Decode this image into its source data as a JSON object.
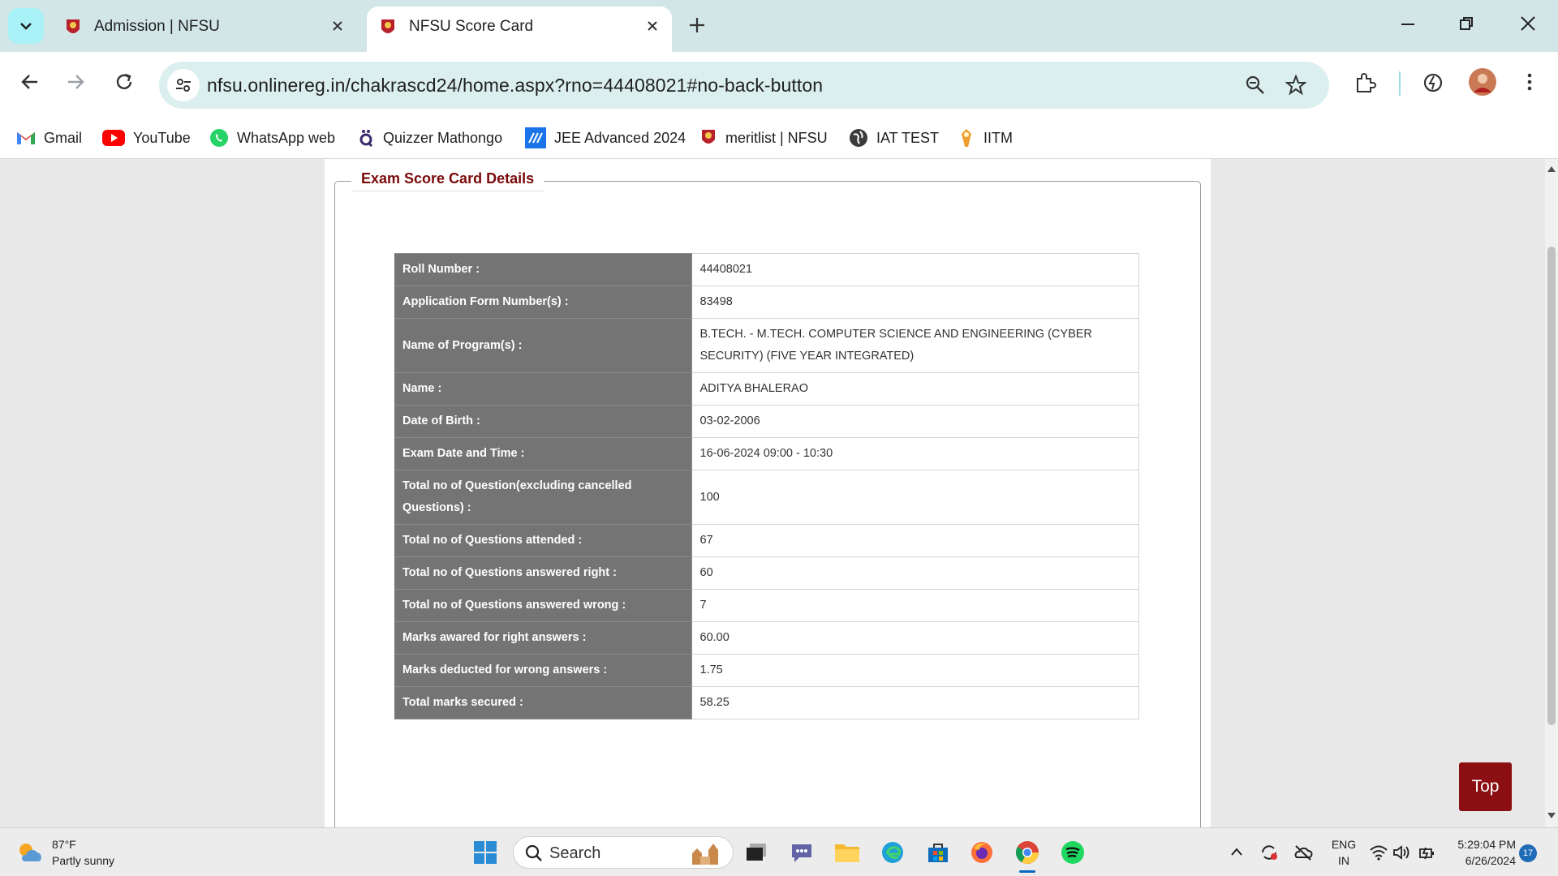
{
  "browser": {
    "tabs": [
      {
        "title": "Admission | NFSU",
        "active": false
      },
      {
        "title": "NFSU Score Card",
        "active": true
      }
    ],
    "url": "nfsu.onlinereg.in/chakrascd24/home.aspx?rno=44408021#no-back-button",
    "bookmarks": [
      {
        "label": "Gmail",
        "icon": "gmail-icon"
      },
      {
        "label": "YouTube",
        "icon": "youtube-icon"
      },
      {
        "label": "WhatsApp web",
        "icon": "whatsapp-icon"
      },
      {
        "label": "Quizzer Mathongo",
        "icon": "quizzer-icon"
      },
      {
        "label": "JEE Advanced 2024",
        "icon": "jee-icon"
      },
      {
        "label": "meritlist | NFSU",
        "icon": "nfsu-icon"
      },
      {
        "label": "IAT TEST",
        "icon": "globe-icon"
      },
      {
        "label": "IITM",
        "icon": "iitm-icon"
      }
    ]
  },
  "page": {
    "legend": "Exam Score Card Details",
    "rows": [
      {
        "label": "Roll Number :",
        "value": "44408021"
      },
      {
        "label": "Application Form Number(s) :",
        "value": "83498"
      },
      {
        "label": "Name of Program(s) :",
        "value": "B.TECH. - M.TECH. COMPUTER SCIENCE AND ENGINEERING (CYBER SECURITY) (FIVE YEAR INTEGRATED)"
      },
      {
        "label": "Name :",
        "value": "ADITYA BHALERAO"
      },
      {
        "label": "Date of Birth :",
        "value": "03-02-2006"
      },
      {
        "label": "Exam Date and Time :",
        "value": "16-06-2024 09:00 - 10:30"
      },
      {
        "label": "Total no of Question(excluding cancelled Questions)   :",
        "value": "100"
      },
      {
        "label": "Total no of Questions attended   :",
        "value": "67"
      },
      {
        "label": "Total no of Questions answered right   :",
        "value": "60"
      },
      {
        "label": "Total no of Questions answered wrong   :",
        "value": "7"
      },
      {
        "label": "Marks awared for right answers   :",
        "value": "60.00"
      },
      {
        "label": "Marks deducted for wrong answers   :",
        "value": "1.75"
      },
      {
        "label": "Total marks secured   :",
        "value": "58.25"
      }
    ],
    "top_button": "Top"
  },
  "taskbar": {
    "weather": {
      "temp": "87°F",
      "condition": "Partly sunny"
    },
    "search_label": "Search",
    "language": {
      "line1": "ENG",
      "line2": "IN"
    },
    "clock": {
      "time": "5:29:04 PM",
      "date": "6/26/2024"
    },
    "notification_count": "17"
  },
  "colors": {
    "legend": "#7a0a0a",
    "label_cell": "#747474",
    "top_button": "#8b0e12",
    "tabstrip": "#d3e6e7",
    "omnibox": "#dcefef"
  }
}
